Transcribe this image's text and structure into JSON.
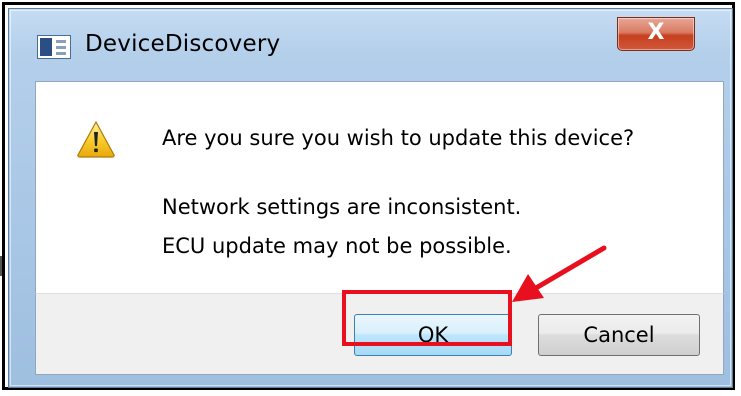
{
  "window": {
    "title": "DeviceDiscovery",
    "close_glyph": "X",
    "icon": "application-window-icon"
  },
  "dialog": {
    "icon": "warning-icon",
    "question": "Are you sure you wish to update this device?",
    "detail_line_1": "Network settings are inconsistent.",
    "detail_line_2": "ECU update may not be possible."
  },
  "buttons": {
    "ok_label": "OK",
    "cancel_label": "Cancel"
  },
  "annotation": {
    "highlight_color": "#e8101e",
    "target": "ok-button"
  },
  "colors": {
    "titlebar": "#b4cfea",
    "close_button": "#c5401f",
    "ok_button_border": "#3c7fb1",
    "button_area": "#f0f0f0"
  }
}
